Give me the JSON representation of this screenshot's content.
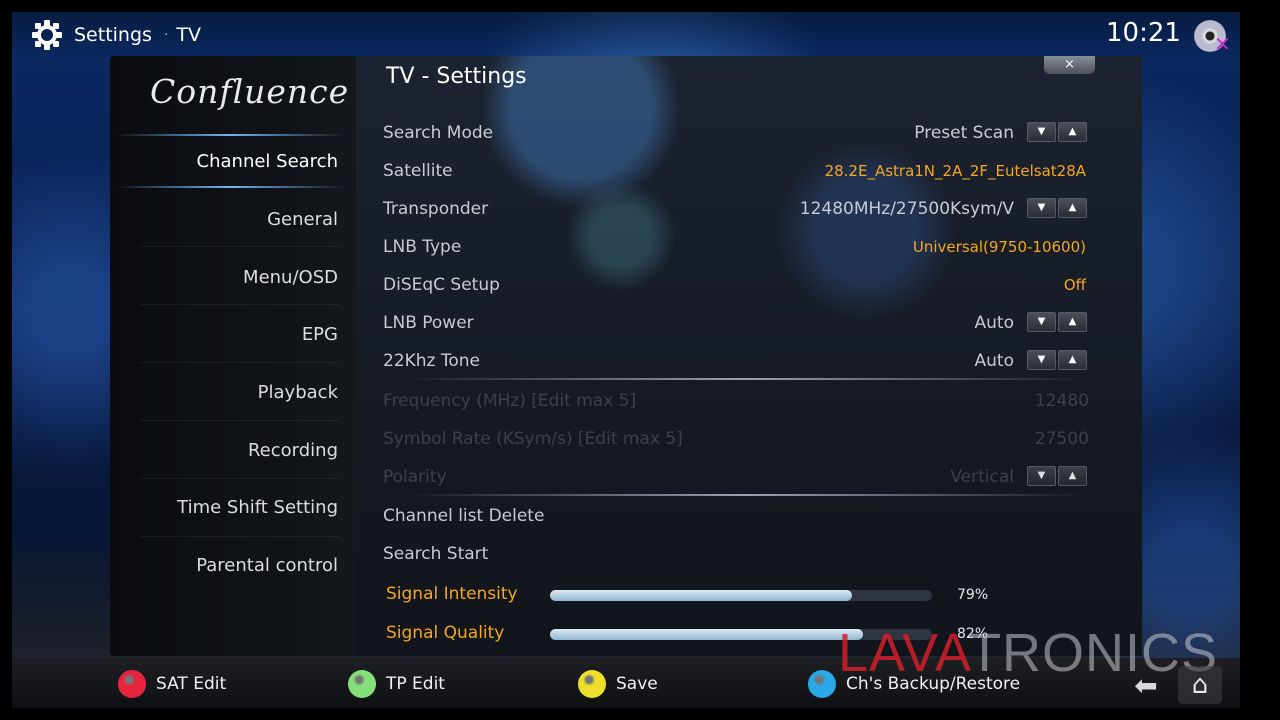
{
  "header": {
    "breadcrumb_root": "Settings",
    "separator": "·",
    "breadcrumb_current": "TV",
    "clock": "10:21",
    "icons": [
      "gear-icon",
      "disc-icon",
      "close-x-icon"
    ]
  },
  "logo": "Confluence",
  "page_title": "TV - Settings",
  "close_label": "×",
  "sidebar": {
    "items": [
      {
        "label": "Channel Search",
        "active": true
      },
      {
        "label": "General"
      },
      {
        "label": "Menu/OSD"
      },
      {
        "label": "EPG"
      },
      {
        "label": "Playback"
      },
      {
        "label": "Recording"
      },
      {
        "label": "Time Shift Setting"
      },
      {
        "label": "Parental control"
      }
    ]
  },
  "settings": [
    {
      "label": "Search Mode",
      "value": "Preset Scan",
      "spinner": true
    },
    {
      "label": "Satellite",
      "value": "28.2E_Astra1N_2A_2F_Eutelsat28A",
      "highlight": true
    },
    {
      "label": "Transponder",
      "value": "12480MHz/27500Ksym/V",
      "spinner": true
    },
    {
      "label": "LNB Type",
      "value": "Universal(9750-10600)",
      "highlight": true
    },
    {
      "label": "DiSEqC Setup",
      "value": "Off",
      "highlight": true
    },
    {
      "label": "LNB Power",
      "value": "Auto",
      "spinner": true
    },
    {
      "label": "22Khz Tone",
      "value": "Auto",
      "spinner": true
    },
    {
      "label": "Frequency (MHz) [Edit max 5]",
      "value": "12480",
      "disabled": true
    },
    {
      "label": "Symbol Rate (KSym/s) [Edit max 5]",
      "value": "27500",
      "disabled": true
    },
    {
      "label": "Polarity",
      "value": "Vertical",
      "spinner": true,
      "disabled": true
    },
    {
      "label": "Channel list Delete"
    },
    {
      "label": "Search Start"
    }
  ],
  "spinner": {
    "down": "▼",
    "up": "▲"
  },
  "signal": {
    "intensity": {
      "label": "Signal Intensity",
      "percent_text": "79%",
      "value": 0.79
    },
    "quality": {
      "label": "Signal Quality",
      "percent_text": "82%",
      "value": 0.82
    }
  },
  "footer": {
    "buttons": [
      {
        "label": "SAT Edit",
        "color": "#e8243c"
      },
      {
        "label": "TP Edit",
        "color": "#86e07a"
      },
      {
        "label": "Save",
        "color": "#f0df2a"
      },
      {
        "label": "Ch's Backup/Restore",
        "color": "#2aa8e8"
      }
    ],
    "back_icon": "back-arrow-icon",
    "home_icon": "home-icon"
  },
  "watermark": {
    "part1": "LAVA",
    "part2": "TRONICS"
  },
  "colors": {
    "accent_orange": "#f5a623",
    "highlight_blue": "#78beff"
  }
}
